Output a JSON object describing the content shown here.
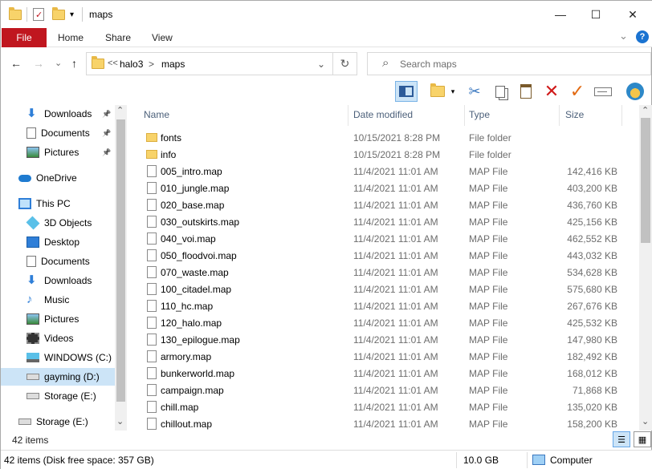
{
  "window": {
    "title": "maps",
    "minimize_glyph": "—",
    "maximize_glyph": "☐",
    "close_glyph": "✕",
    "expand_ribbon_glyph": "⌄",
    "help_glyph": "?"
  },
  "ribbon": {
    "tabs": [
      "File",
      "Home",
      "Share",
      "View"
    ]
  },
  "address": {
    "overflow": "<<",
    "path": [
      "halo3",
      "maps"
    ],
    "sep": ">",
    "search_placeholder": "Search maps"
  },
  "nav_glyphs": {
    "back": "←",
    "forward": "→",
    "recent": "⌄",
    "up": "↑",
    "dropdown": "⌄",
    "refresh": "↻",
    "search": "⌕"
  },
  "toolbar": {
    "icons": [
      "preview-pane-icon",
      "new-folder-icon",
      "cut-icon",
      "copy-icon",
      "paste-icon",
      "delete-icon",
      "select-check-icon",
      "rename-icon",
      "halo-shell-icon"
    ]
  },
  "navigation": [
    {
      "label": "Downloads",
      "icon": "download-arrow-icon",
      "pinned": true,
      "indent": 1
    },
    {
      "label": "Documents",
      "icon": "document-icon",
      "pinned": true,
      "indent": 1
    },
    {
      "label": "Pictures",
      "icon": "pictures-icon",
      "pinned": true,
      "indent": 1
    },
    {
      "label": "OneDrive",
      "icon": "onedrive-cloud-icon",
      "pinned": false,
      "indent": 0
    },
    {
      "label": "This PC",
      "icon": "this-pc-icon",
      "pinned": false,
      "indent": 0
    },
    {
      "label": "3D Objects",
      "icon": "3d-objects-icon",
      "pinned": false,
      "indent": 1
    },
    {
      "label": "Desktop",
      "icon": "desktop-icon",
      "pinned": false,
      "indent": 1
    },
    {
      "label": "Documents",
      "icon": "document-icon",
      "pinned": false,
      "indent": 1
    },
    {
      "label": "Downloads",
      "icon": "download-arrow-icon",
      "pinned": false,
      "indent": 1
    },
    {
      "label": "Music",
      "icon": "music-note-icon",
      "pinned": false,
      "indent": 1
    },
    {
      "label": "Pictures",
      "icon": "pictures-icon",
      "pinned": false,
      "indent": 1
    },
    {
      "label": "Videos",
      "icon": "videos-icon",
      "pinned": false,
      "indent": 1
    },
    {
      "label": "WINDOWS (C:)",
      "icon": "windows-drive-icon",
      "pinned": false,
      "indent": 1
    },
    {
      "label": "gayming (D:)",
      "icon": "drive-icon",
      "pinned": false,
      "indent": 1,
      "selected": true
    },
    {
      "label": "Storage (E:)",
      "icon": "drive-icon",
      "pinned": false,
      "indent": 1
    },
    {
      "label": "Storage (E:)",
      "icon": "drive-icon",
      "pinned": false,
      "indent": 0
    }
  ],
  "nav_scroll_glyphs": {
    "up": "⌃",
    "down": "⌄"
  },
  "columns": {
    "name": "Name",
    "date": "Date modified",
    "type": "Type",
    "size": "Size",
    "sort_glyph": "⌃"
  },
  "files": [
    {
      "name": "fonts",
      "date": "10/15/2021 8:28 PM",
      "type": "File folder",
      "size": "",
      "folder": true
    },
    {
      "name": "info",
      "date": "10/15/2021 8:28 PM",
      "type": "File folder",
      "size": "",
      "folder": true
    },
    {
      "name": "005_intro.map",
      "date": "11/4/2021 11:01 AM",
      "type": "MAP File",
      "size": "142,416 KB"
    },
    {
      "name": "010_jungle.map",
      "date": "11/4/2021 11:01 AM",
      "type": "MAP File",
      "size": "403,200 KB"
    },
    {
      "name": "020_base.map",
      "date": "11/4/2021 11:01 AM",
      "type": "MAP File",
      "size": "436,760 KB"
    },
    {
      "name": "030_outskirts.map",
      "date": "11/4/2021 11:01 AM",
      "type": "MAP File",
      "size": "425,156 KB"
    },
    {
      "name": "040_voi.map",
      "date": "11/4/2021 11:01 AM",
      "type": "MAP File",
      "size": "462,552 KB"
    },
    {
      "name": "050_floodvoi.map",
      "date": "11/4/2021 11:01 AM",
      "type": "MAP File",
      "size": "443,032 KB"
    },
    {
      "name": "070_waste.map",
      "date": "11/4/2021 11:01 AM",
      "type": "MAP File",
      "size": "534,628 KB"
    },
    {
      "name": "100_citadel.map",
      "date": "11/4/2021 11:01 AM",
      "type": "MAP File",
      "size": "575,680 KB"
    },
    {
      "name": "110_hc.map",
      "date": "11/4/2021 11:01 AM",
      "type": "MAP File",
      "size": "267,676 KB"
    },
    {
      "name": "120_halo.map",
      "date": "11/4/2021 11:01 AM",
      "type": "MAP File",
      "size": "425,532 KB"
    },
    {
      "name": "130_epilogue.map",
      "date": "11/4/2021 11:01 AM",
      "type": "MAP File",
      "size": "147,980 KB"
    },
    {
      "name": "armory.map",
      "date": "11/4/2021 11:01 AM",
      "type": "MAP File",
      "size": "182,492 KB"
    },
    {
      "name": "bunkerworld.map",
      "date": "11/4/2021 11:01 AM",
      "type": "MAP File",
      "size": "168,012 KB"
    },
    {
      "name": "campaign.map",
      "date": "11/4/2021 11:01 AM",
      "type": "MAP File",
      "size": "71,868 KB"
    },
    {
      "name": "chill.map",
      "date": "11/4/2021 11:01 AM",
      "type": "MAP File",
      "size": "135,020 KB"
    },
    {
      "name": "chillout.map",
      "date": "11/4/2021 11:01 AM",
      "type": "MAP File",
      "size": "158,200 KB"
    }
  ],
  "content_scroll_glyphs": {
    "up": "⌃",
    "down": "⌄"
  },
  "status": {
    "item_count": "42 items",
    "disk_free": "42 items (Disk free space: 357 GB)",
    "selection_size": "10.0 GB",
    "location": "Computer"
  },
  "colors": {
    "file_tab": "#c0161f",
    "selected": "#cce4f7",
    "header_text": "#4c607a",
    "row_text_gray": "#6d6d6d"
  }
}
